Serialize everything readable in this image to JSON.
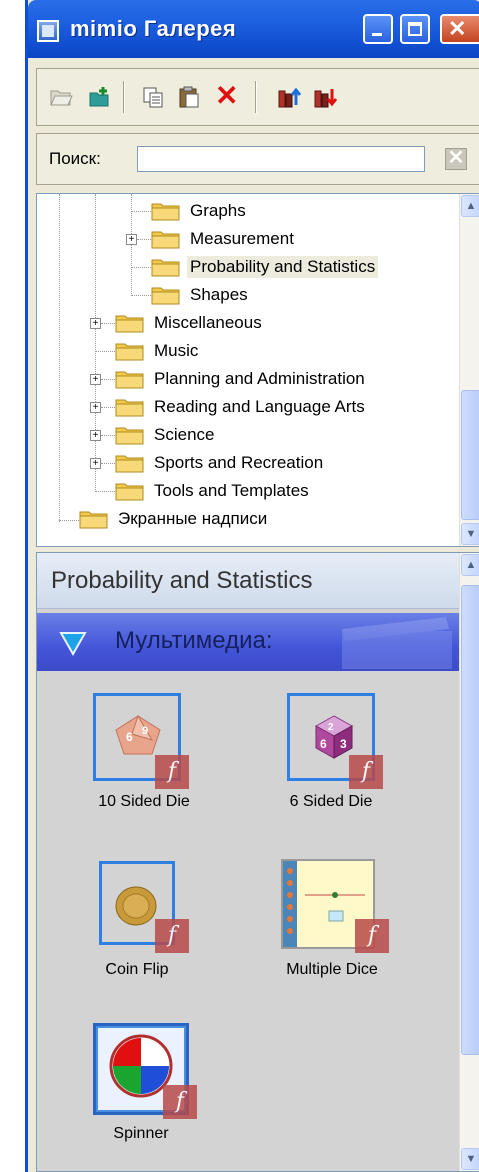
{
  "window": {
    "title": "mimio Галерея"
  },
  "toolbar": {
    "buttons": [
      "open-folder-icon",
      "new-folder-icon",
      "copy-icon",
      "paste-icon",
      "delete-icon",
      "import-icon",
      "export-icon"
    ]
  },
  "search": {
    "label": "Поиск:",
    "value": "",
    "clear_glyph": "✕"
  },
  "tree": {
    "items": [
      {
        "label": "Graphs",
        "expanded": null
      },
      {
        "label": "Measurement",
        "expanded": false
      },
      {
        "label": "Probability and Statistics",
        "expanded": null,
        "selected": true
      },
      {
        "label": "Shapes",
        "expanded": null
      },
      {
        "label": "Miscellaneous",
        "expanded": false
      },
      {
        "label": "Music",
        "expanded": null
      },
      {
        "label": "Planning and Administration",
        "expanded": false
      },
      {
        "label": "Reading and Language Arts",
        "expanded": false
      },
      {
        "label": "Science",
        "expanded": false
      },
      {
        "label": "Sports and Recreation",
        "expanded": false
      },
      {
        "label": "Tools and Templates",
        "expanded": null
      },
      {
        "label": "Экранные надписи",
        "expanded": null
      }
    ]
  },
  "gallery": {
    "category_title": "Probability and Statistics",
    "section_label": "Мультимедиа:",
    "items": [
      {
        "label": "10 Sided Die",
        "icon": "ten-sided-die-icon",
        "badge": "f"
      },
      {
        "label": "6 Sided Die",
        "icon": "six-sided-die-icon",
        "badge": "f"
      },
      {
        "label": "Coin Flip",
        "icon": "coin-icon",
        "badge": "f"
      },
      {
        "label": "Multiple Dice",
        "icon": "multiple-dice-icon",
        "badge": "f"
      },
      {
        "label": "Spinner",
        "icon": "spinner-icon",
        "badge": "f"
      }
    ]
  },
  "scroll_glyphs": {
    "up": "▲",
    "down": "▼"
  },
  "colors": {
    "titlebar": "#0b45c6",
    "media_bar": "#4455d8",
    "thumb_border": "#2f7fe3",
    "flash_badge": "#b84a4a",
    "folder": "#f2c94c"
  }
}
